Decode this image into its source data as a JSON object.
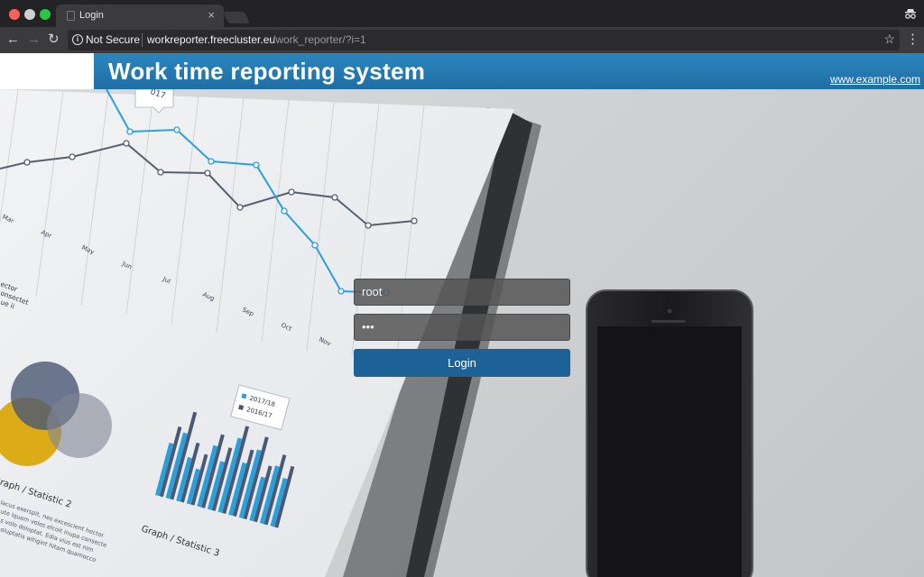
{
  "browser": {
    "tab_title": "Login",
    "tab_close": "×",
    "security_label": "Not Secure",
    "url_host": "workreporter.freecluster.eu",
    "url_path": "/work_reporter/?i=1",
    "icons": [
      "back-icon",
      "forward-icon",
      "reload-icon",
      "info-icon",
      "star-icon",
      "menu-icon",
      "incognito-icon",
      "new-tab-icon"
    ]
  },
  "header": {
    "title": "Work time reporting system",
    "link_text": "www.example.com",
    "bar_color": "#1f6ea4"
  },
  "login": {
    "username_value": "root",
    "password_value": "•••",
    "button_label": "Login",
    "button_color": "#1c6297"
  },
  "background_photo": {
    "axis_months": [
      "Mar",
      "Apr",
      "May",
      "Jun",
      "Jul",
      "Aug",
      "Sep",
      "Oct",
      "Nov"
    ],
    "legend": [
      "2017/18",
      "2016/17"
    ],
    "captions": [
      "Graph / Statistic 2",
      "Graph / Statistic 3"
    ],
    "fragments": [
      "ector",
      "onsectet",
      "ue ii"
    ]
  }
}
